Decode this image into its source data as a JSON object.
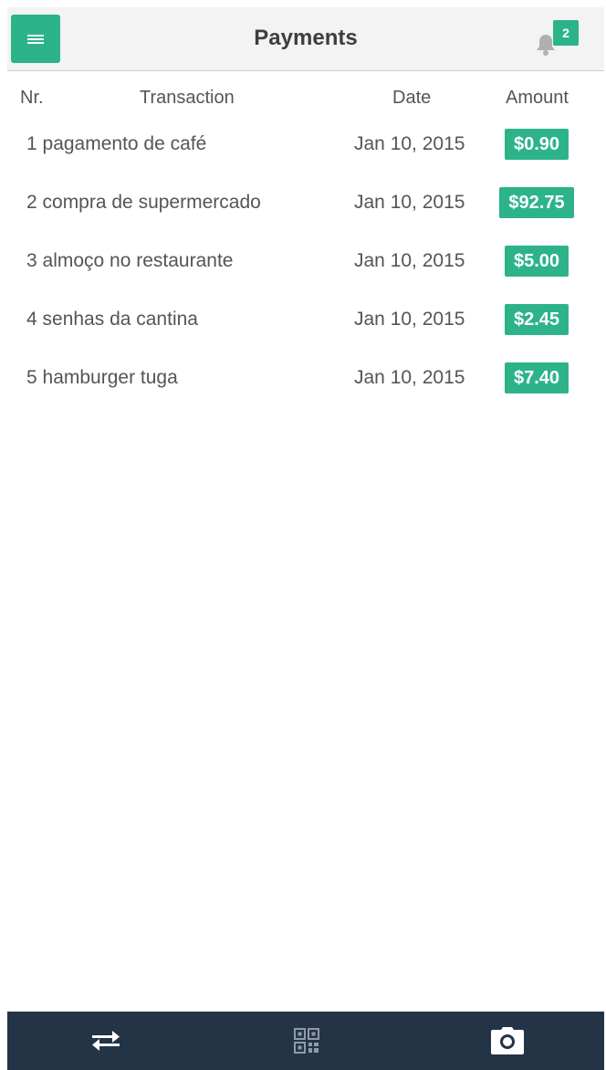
{
  "header": {
    "title": "Payments",
    "notification_count": "2",
    "menu_icon": "hamburger-menu-icon",
    "bell_icon": "bell-icon"
  },
  "table": {
    "columns": [
      "Nr.",
      "Transaction",
      "Date",
      "Amount"
    ],
    "rows": [
      {
        "desc": "1 pagamento de café",
        "date": "Jan 10, 2015",
        "amount": "$0.90"
      },
      {
        "desc": "2 compra de supermercado",
        "date": "Jan 10, 2015",
        "amount": "$92.75"
      },
      {
        "desc": "3 almoço no restaurante",
        "date": "Jan 10, 2015",
        "amount": "$5.00"
      },
      {
        "desc": "4 senhas da cantina",
        "date": "Jan 10, 2015",
        "amount": "$2.45"
      },
      {
        "desc": "5 hamburger tuga",
        "date": "Jan 10, 2015",
        "amount": "$7.40"
      }
    ]
  },
  "footer": {
    "tabs": [
      {
        "icon": "transfer-arrows-icon"
      },
      {
        "icon": "qr-code-icon"
      },
      {
        "icon": "camera-icon"
      }
    ]
  },
  "colors": {
    "accent": "#2db38a",
    "footer_bg": "#243447",
    "header_bg": "#f3f3f3"
  }
}
